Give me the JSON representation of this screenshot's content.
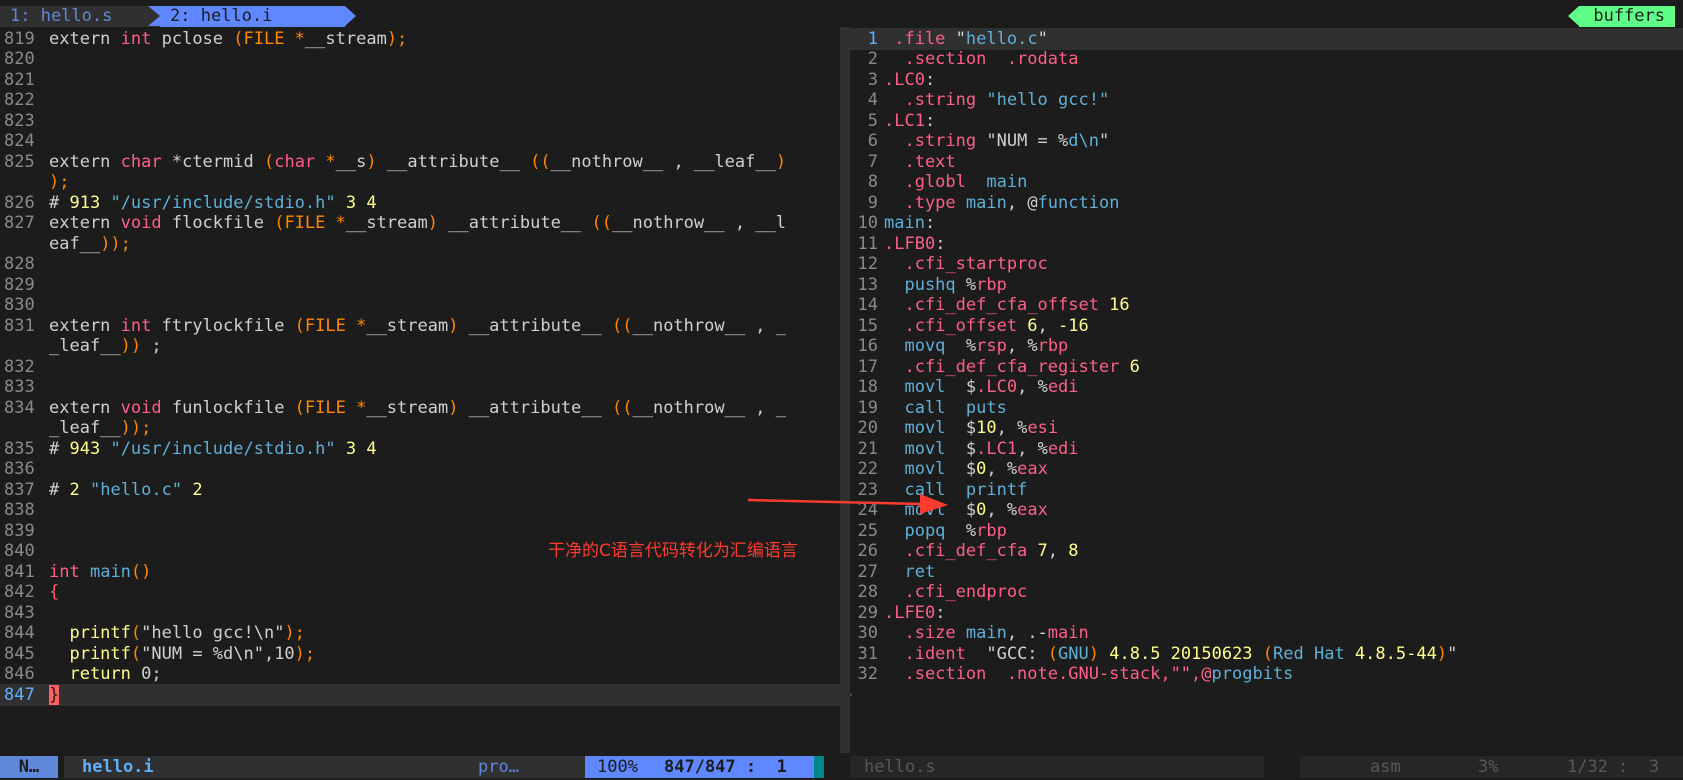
{
  "tabs": [
    {
      "label": "1: hello.s"
    },
    {
      "label": "2: hello.i"
    }
  ],
  "buffers_label": "buffers",
  "left_lines": [
    {
      "n": "819",
      "parts": [
        [
          "extern ",
          ""
        ],
        [
          "int",
          "kw"
        ],
        [
          " pclose ",
          ""
        ],
        [
          "(FILE *",
          "par"
        ],
        [
          "__stream",
          ""
        ],
        [
          ");",
          "par"
        ]
      ]
    },
    {
      "n": "820",
      "parts": []
    },
    {
      "n": "821",
      "parts": []
    },
    {
      "n": "822",
      "parts": []
    },
    {
      "n": "823",
      "parts": []
    },
    {
      "n": "824",
      "parts": []
    },
    {
      "n": "825",
      "parts": [
        [
          "extern ",
          ""
        ],
        [
          "char",
          "kw"
        ],
        [
          " *ctermid ",
          ""
        ],
        [
          "(",
          "par"
        ],
        [
          "char",
          "kw"
        ],
        [
          " *",
          "par"
        ],
        [
          "__s",
          ""
        ],
        [
          ")",
          "par"
        ],
        [
          " __attribute__ ",
          ""
        ],
        [
          "((",
          "par"
        ],
        [
          "__nothrow__ , __leaf__",
          ""
        ],
        [
          ")",
          "par"
        ]
      ]
    },
    {
      "n": "",
      "parts": [
        [
          ");",
          "par"
        ]
      ]
    },
    {
      "n": "826",
      "parts": [
        [
          "# ",
          ""
        ],
        [
          "913",
          "num"
        ],
        [
          " ",
          ""
        ],
        [
          "\"/usr/include/stdio.h\"",
          "str"
        ],
        [
          " ",
          ""
        ],
        [
          "3",
          "num"
        ],
        [
          " ",
          ""
        ],
        [
          "4",
          "num"
        ]
      ]
    },
    {
      "n": "827",
      "parts": [
        [
          "extern ",
          ""
        ],
        [
          "void",
          "kw"
        ],
        [
          " flockfile ",
          ""
        ],
        [
          "(FILE *",
          "par"
        ],
        [
          "__stream",
          ""
        ],
        [
          ")",
          "par"
        ],
        [
          " __attribute__ ",
          ""
        ],
        [
          "((",
          "par"
        ],
        [
          "__nothrow__ , __l",
          ""
        ]
      ]
    },
    {
      "n": "",
      "parts": [
        [
          "eaf__",
          ""
        ],
        [
          "));",
          "par"
        ]
      ]
    },
    {
      "n": "828",
      "parts": []
    },
    {
      "n": "829",
      "parts": []
    },
    {
      "n": "830",
      "parts": []
    },
    {
      "n": "831",
      "parts": [
        [
          "extern ",
          ""
        ],
        [
          "int",
          "kw"
        ],
        [
          " ftrylockfile ",
          ""
        ],
        [
          "(FILE *",
          "par"
        ],
        [
          "__stream",
          ""
        ],
        [
          ")",
          "par"
        ],
        [
          " __attribute__ ",
          ""
        ],
        [
          "((",
          "par"
        ],
        [
          "__nothrow__ , _",
          ""
        ]
      ]
    },
    {
      "n": "",
      "parts": [
        [
          "_leaf__",
          ""
        ],
        [
          "))",
          "par"
        ],
        [
          " ;",
          ""
        ]
      ]
    },
    {
      "n": "832",
      "parts": []
    },
    {
      "n": "833",
      "parts": []
    },
    {
      "n": "834",
      "parts": [
        [
          "extern ",
          ""
        ],
        [
          "void",
          "kw"
        ],
        [
          " funlockfile ",
          ""
        ],
        [
          "(FILE *",
          "par"
        ],
        [
          "__stream",
          ""
        ],
        [
          ")",
          "par"
        ],
        [
          " __attribute__ ",
          ""
        ],
        [
          "((",
          "par"
        ],
        [
          "__nothrow__ , _",
          ""
        ]
      ]
    },
    {
      "n": "",
      "parts": [
        [
          "_leaf__",
          ""
        ],
        [
          "));",
          "par"
        ]
      ]
    },
    {
      "n": "835",
      "parts": [
        [
          "# ",
          ""
        ],
        [
          "943",
          "num"
        ],
        [
          " ",
          ""
        ],
        [
          "\"/usr/include/stdio.h\"",
          "str"
        ],
        [
          " ",
          ""
        ],
        [
          "3",
          "num"
        ],
        [
          " ",
          ""
        ],
        [
          "4",
          "num"
        ]
      ]
    },
    {
      "n": "836",
      "parts": []
    },
    {
      "n": "837",
      "parts": [
        [
          "# ",
          ""
        ],
        [
          "2",
          "num"
        ],
        [
          " ",
          ""
        ],
        [
          "\"hello.c\"",
          "str"
        ],
        [
          " ",
          ""
        ],
        [
          "2",
          "num"
        ]
      ]
    },
    {
      "n": "838",
      "parts": []
    },
    {
      "n": "839",
      "parts": []
    },
    {
      "n": "840",
      "parts": []
    },
    {
      "n": "841",
      "parts": [
        [
          "int",
          "kw"
        ],
        [
          " ",
          ""
        ],
        [
          "main",
          "fn"
        ],
        [
          "()",
          "par"
        ]
      ]
    },
    {
      "n": "842",
      "parts": [
        [
          "{",
          "brace"
        ]
      ]
    },
    {
      "n": "843",
      "parts": []
    },
    {
      "n": "844",
      "parts": [
        [
          "  printf",
          "num"
        ],
        [
          "(",
          "par"
        ],
        [
          "\"hello gcc!\\n\"",
          ""
        ],
        [
          ");",
          "par"
        ]
      ]
    },
    {
      "n": "845",
      "parts": [
        [
          "  printf",
          "num"
        ],
        [
          "(",
          "par"
        ],
        [
          "\"NUM = %d\\n\",10",
          ""
        ],
        [
          ");",
          "par"
        ]
      ]
    },
    {
      "n": "846",
      "parts": [
        [
          "  ",
          ""
        ],
        [
          "return",
          "num"
        ],
        [
          " 0;",
          ""
        ]
      ]
    },
    {
      "n": "847",
      "parts": [
        [
          "}",
          "brace-cur"
        ]
      ],
      "current": true
    }
  ],
  "right_lines": [
    {
      "n": "1",
      "parts": [
        [
          " .file ",
          "dir"
        ],
        [
          "\"",
          ""
        ],
        [
          "hello.c",
          "str"
        ],
        [
          "\"",
          ""
        ]
      ],
      "current": true
    },
    {
      "n": "2",
      "parts": [
        [
          "  .section  .rodata",
          "dir"
        ]
      ]
    },
    {
      "n": "3",
      "parts": [
        [
          ".LC0",
          "dir"
        ],
        [
          ":",
          ""
        ]
      ]
    },
    {
      "n": "4",
      "parts": [
        [
          "  .string ",
          "dir"
        ],
        [
          "\"hello gcc!\"",
          "lbl"
        ]
      ]
    },
    {
      "n": "5",
      "parts": [
        [
          ".LC1",
          "dir"
        ],
        [
          ":",
          ""
        ]
      ]
    },
    {
      "n": "6",
      "parts": [
        [
          "  .string ",
          "dir"
        ],
        [
          "\"NUM = %",
          ""
        ],
        [
          "d",
          "lbl"
        ],
        [
          "\\n",
          "lbl"
        ],
        [
          "\"",
          ""
        ]
      ]
    },
    {
      "n": "7",
      "parts": [
        [
          "  .text",
          "dir"
        ]
      ]
    },
    {
      "n": "8",
      "parts": [
        [
          "  .globl  ",
          "dir"
        ],
        [
          "main",
          "lbl"
        ]
      ]
    },
    {
      "n": "9",
      "parts": [
        [
          "  .type ",
          "dir"
        ],
        [
          "main",
          "lbl"
        ],
        [
          ", @",
          ""
        ],
        [
          "function",
          "lbl"
        ]
      ]
    },
    {
      "n": "10",
      "parts": [
        [
          "main",
          "lbl"
        ],
        [
          ":",
          ""
        ]
      ]
    },
    {
      "n": "11",
      "parts": [
        [
          ".LFB0",
          "dir"
        ],
        [
          ":",
          ""
        ]
      ]
    },
    {
      "n": "12",
      "parts": [
        [
          "  .cfi_startproc",
          "dir"
        ]
      ]
    },
    {
      "n": "13",
      "parts": [
        [
          "  pushq ",
          "lbl"
        ],
        [
          "%",
          ""
        ],
        [
          "rbp",
          "kw"
        ]
      ]
    },
    {
      "n": "14",
      "parts": [
        [
          "  .cfi_def_cfa_offset ",
          "dir"
        ],
        [
          "16",
          "num"
        ]
      ]
    },
    {
      "n": "15",
      "parts": [
        [
          "  .cfi_offset ",
          "dir"
        ],
        [
          "6",
          "num"
        ],
        [
          ", ",
          ""
        ],
        [
          "-16",
          "num"
        ]
      ]
    },
    {
      "n": "16",
      "parts": [
        [
          "  movq  ",
          "lbl"
        ],
        [
          "%",
          ""
        ],
        [
          "rsp",
          "kw"
        ],
        [
          ", %",
          ""
        ],
        [
          "rbp",
          "kw"
        ]
      ]
    },
    {
      "n": "17",
      "parts": [
        [
          "  .cfi_def_cfa_register ",
          "dir"
        ],
        [
          "6",
          "num"
        ]
      ]
    },
    {
      "n": "18",
      "parts": [
        [
          "  movl  ",
          "lbl"
        ],
        [
          "$",
          ""
        ],
        [
          ".LC0",
          "dir"
        ],
        [
          ", %",
          ""
        ],
        [
          "edi",
          "kw"
        ]
      ]
    },
    {
      "n": "19",
      "parts": [
        [
          "  call  puts",
          "lbl"
        ]
      ]
    },
    {
      "n": "20",
      "parts": [
        [
          "  movl  ",
          "lbl"
        ],
        [
          "$",
          ""
        ],
        [
          "10",
          "num"
        ],
        [
          ", %",
          ""
        ],
        [
          "esi",
          "kw"
        ]
      ]
    },
    {
      "n": "21",
      "parts": [
        [
          "  movl  ",
          "lbl"
        ],
        [
          "$",
          ""
        ],
        [
          ".LC1",
          "dir"
        ],
        [
          ", %",
          ""
        ],
        [
          "edi",
          "kw"
        ]
      ]
    },
    {
      "n": "22",
      "parts": [
        [
          "  movl  ",
          "lbl"
        ],
        [
          "$",
          ""
        ],
        [
          "0",
          "num"
        ],
        [
          ", %",
          ""
        ],
        [
          "eax",
          "kw"
        ]
      ]
    },
    {
      "n": "23",
      "parts": [
        [
          "  call  printf",
          "lbl"
        ]
      ]
    },
    {
      "n": "24",
      "parts": [
        [
          "  movl  ",
          "lbl"
        ],
        [
          "$",
          ""
        ],
        [
          "0",
          "num"
        ],
        [
          ", %",
          ""
        ],
        [
          "eax",
          "kw"
        ]
      ]
    },
    {
      "n": "25",
      "parts": [
        [
          "  popq  ",
          "lbl"
        ],
        [
          "%",
          ""
        ],
        [
          "rbp",
          "kw"
        ]
      ]
    },
    {
      "n": "26",
      "parts": [
        [
          "  .cfi_def_cfa ",
          "dir"
        ],
        [
          "7",
          "num"
        ],
        [
          ", ",
          ""
        ],
        [
          "8",
          "num"
        ]
      ]
    },
    {
      "n": "27",
      "parts": [
        [
          "  ret",
          "lbl"
        ]
      ]
    },
    {
      "n": "28",
      "parts": [
        [
          "  .cfi_endproc",
          "dir"
        ]
      ]
    },
    {
      "n": "29",
      "parts": [
        [
          ".LFE0",
          "dir"
        ],
        [
          ":",
          ""
        ]
      ]
    },
    {
      "n": "30",
      "parts": [
        [
          "  .size ",
          "dir"
        ],
        [
          "main",
          "lbl"
        ],
        [
          ", .-",
          ""
        ],
        [
          "main",
          "kw"
        ]
      ]
    },
    {
      "n": "31",
      "parts": [
        [
          "  .ident  ",
          "dir"
        ],
        [
          "\"GCC: ",
          ""
        ],
        [
          "(",
          "par"
        ],
        [
          "GNU",
          "lbl"
        ],
        [
          ")",
          "par"
        ],
        [
          " ",
          ""
        ],
        [
          "4.8.5 20150623 ",
          "num"
        ],
        [
          "(",
          "par"
        ],
        [
          "Red Hat ",
          "lbl"
        ],
        [
          "4.8.5-44",
          "num"
        ],
        [
          ")",
          "par"
        ],
        [
          "\"",
          ""
        ]
      ]
    },
    {
      "n": "32",
      "parts": [
        [
          "  .section  .note.GNU-stack,\"\",@",
          "dir"
        ],
        [
          "progbits",
          "lbl"
        ]
      ]
    }
  ],
  "tilde": "~",
  "status": {
    "mode": "N…",
    "file": "hello.i",
    "filetype": "pro…",
    "percent": "100%",
    "position": "847/847 :  1",
    "right_file": "hello.s",
    "right_filetype": "asm",
    "right_percent": "3%",
    "right_position": "1/32 :  3"
  },
  "annotation": "干净的C语言代码转化为汇编语言",
  "colors": {
    "arrow": "#ff3b30",
    "accent": "#5f87ff",
    "buffers": "#5fff87"
  }
}
